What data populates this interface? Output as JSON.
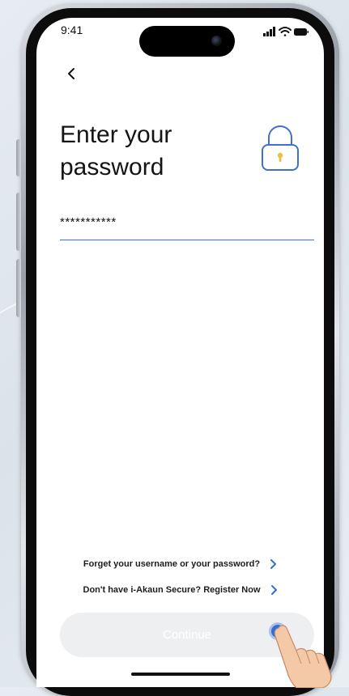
{
  "status_bar": {
    "time": "9:41"
  },
  "screen": {
    "title": "Enter your\npassword",
    "password_field": {
      "value": "***********"
    },
    "links": [
      {
        "label": "Forget your username or your password?"
      },
      {
        "label": "Don't have i-Akaun Secure? Register Now"
      }
    ],
    "continue_label": "Continue"
  },
  "colors": {
    "accent": "#3f6fd1",
    "lock_body": "#e9c044",
    "button_bg": "#eeeff1"
  },
  "icons": {
    "back": "chevron-left-icon",
    "lock": "lock-icon",
    "link_chevron": "chevron-right-icon"
  }
}
